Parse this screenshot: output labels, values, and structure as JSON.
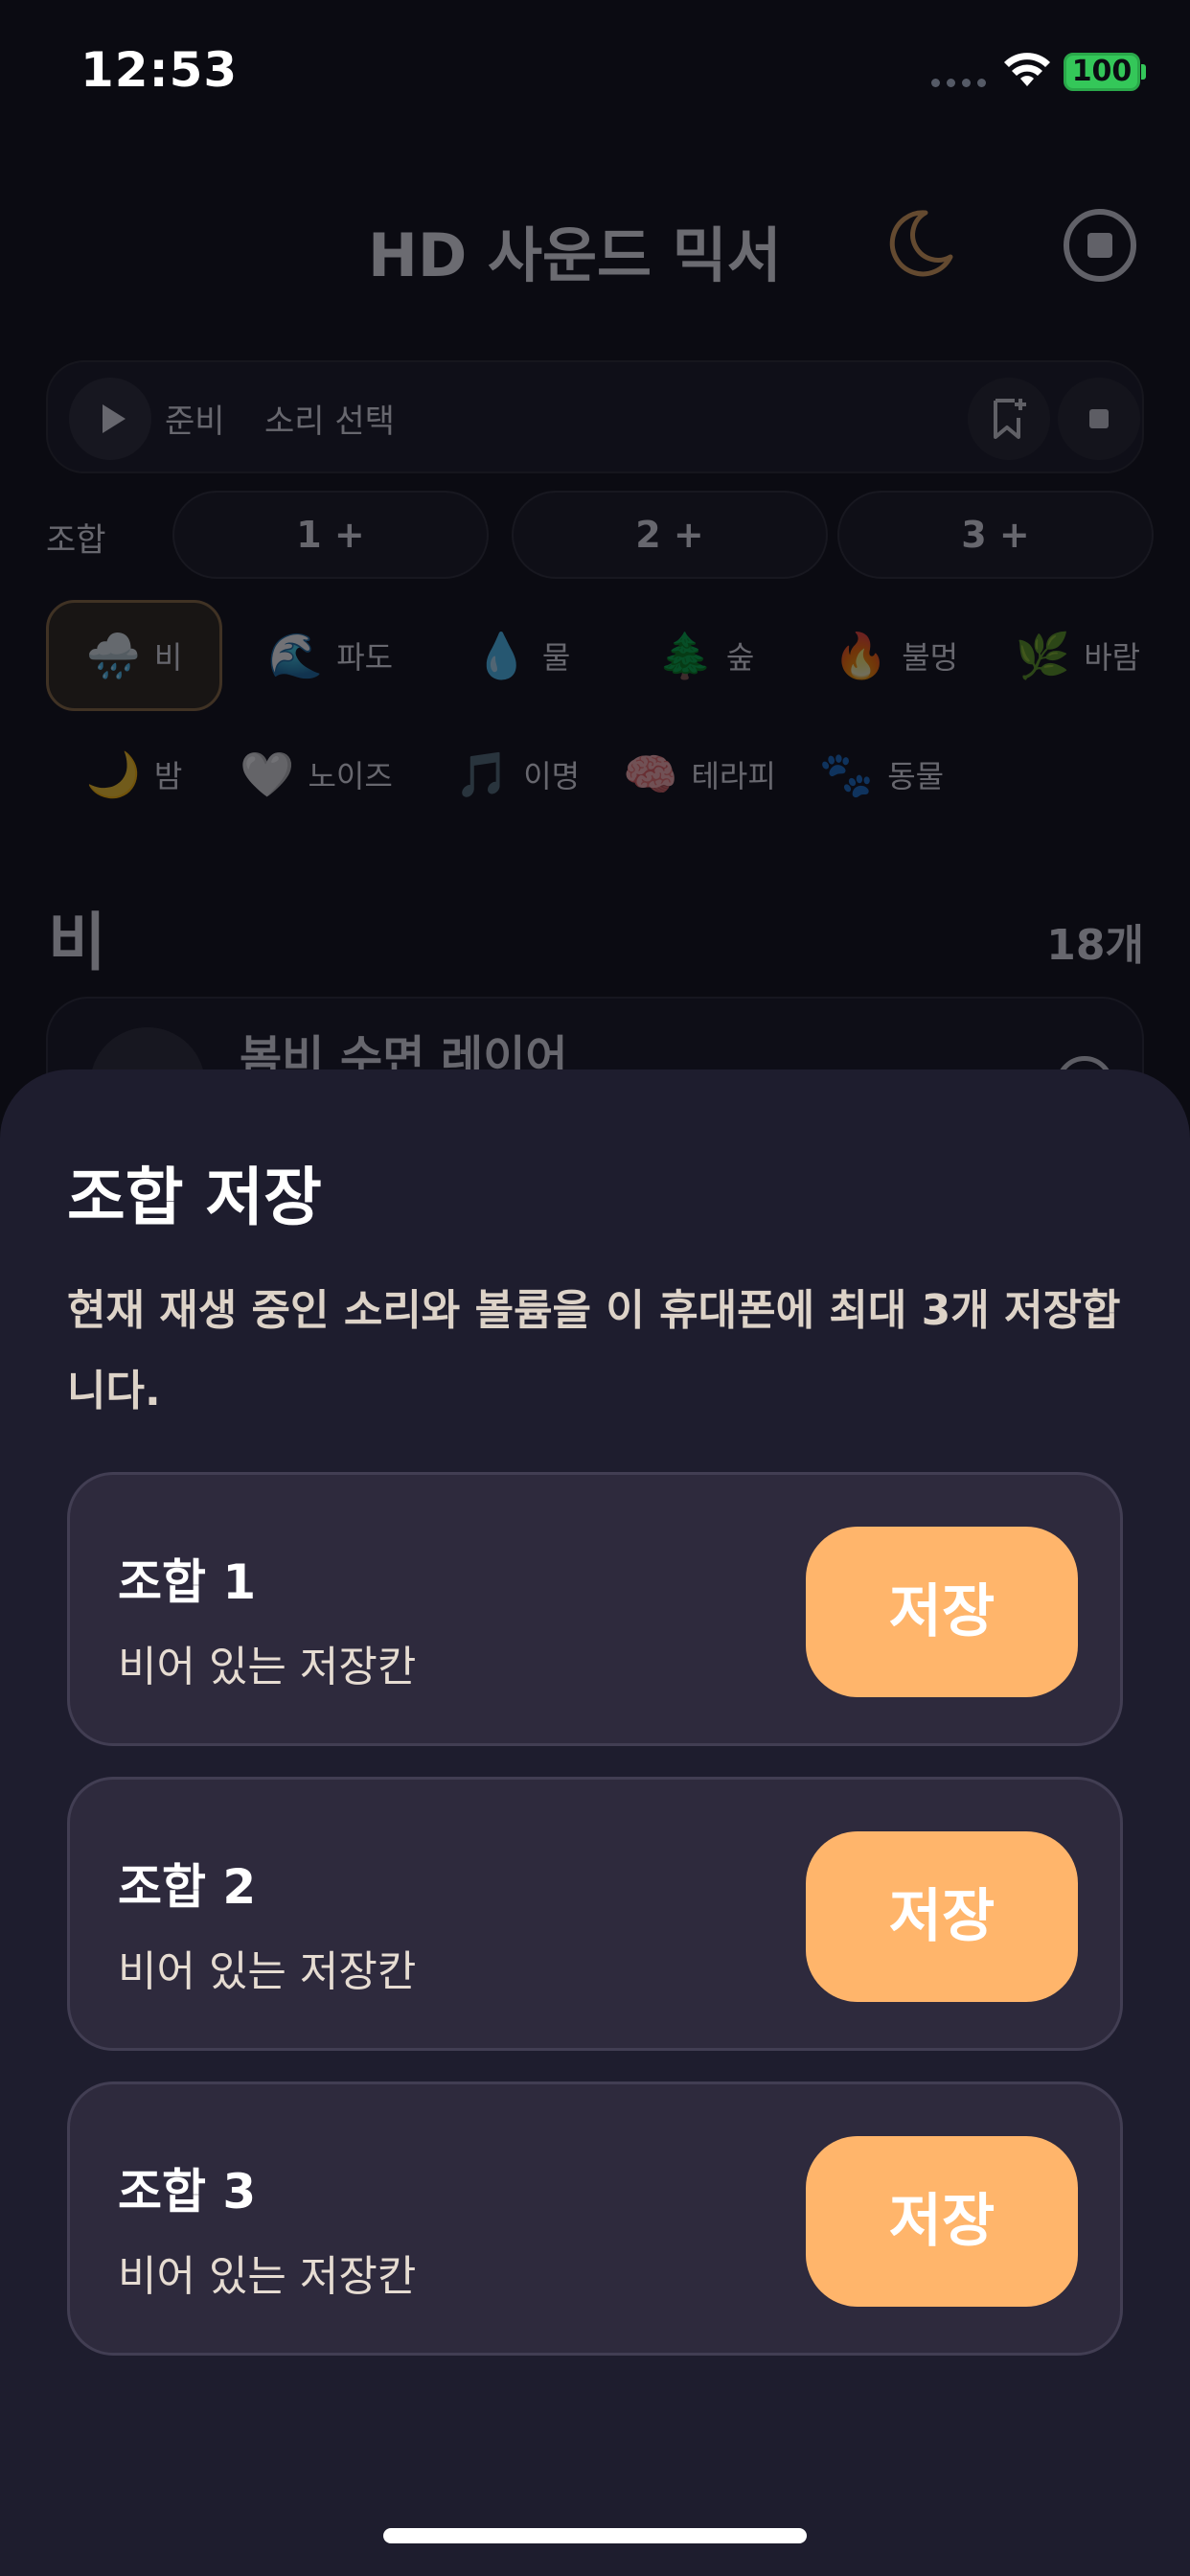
{
  "status_bar": {
    "time": "12:53",
    "battery": "100"
  },
  "header": {
    "title": "HD 사운드 믹서"
  },
  "player": {
    "status": "준비",
    "current_sound": "소리 선택"
  },
  "combos": {
    "label": "조합",
    "slots": [
      {
        "label": "1 +"
      },
      {
        "label": "2 +"
      },
      {
        "label": "3 +"
      }
    ]
  },
  "categories": [
    {
      "emoji": "🌧️",
      "label": "비",
      "selected": true
    },
    {
      "emoji": "🌊",
      "label": "파도"
    },
    {
      "emoji": "💧",
      "label": "물"
    },
    {
      "emoji": "🌲",
      "label": "숲"
    },
    {
      "emoji": "🔥",
      "label": "불멍"
    },
    {
      "emoji": "🌿",
      "label": "바람"
    },
    {
      "emoji": "🌙",
      "label": "밤"
    },
    {
      "emoji": "🤍",
      "label": "노이즈"
    },
    {
      "emoji": "🎵",
      "label": "이명"
    },
    {
      "emoji": "🧠",
      "label": "테라피"
    },
    {
      "emoji": "🐾",
      "label": "동물"
    }
  ],
  "section": {
    "title": "비",
    "count": "18개"
  },
  "sound_list": [
    {
      "name": "봄비 수면 레이어"
    }
  ],
  "sheet": {
    "title": "조합 저장",
    "description": "현재 재생 중인 소리와 볼륨을 이 휴대폰에 최대 3개 저장합니다.",
    "slots": [
      {
        "name": "조합 1",
        "status": "비어 있는 저장칸",
        "button": "저장"
      },
      {
        "name": "조합 2",
        "status": "비어 있는 저장칸",
        "button": "저장"
      },
      {
        "name": "조합 3",
        "status": "비어 있는 저장칸",
        "button": "저장"
      }
    ]
  },
  "colors": {
    "accent": "#ffb56b",
    "sheet_background": "#1e1d2e",
    "card_background": "#2e2a3d",
    "app_background": "#0b0b12"
  }
}
